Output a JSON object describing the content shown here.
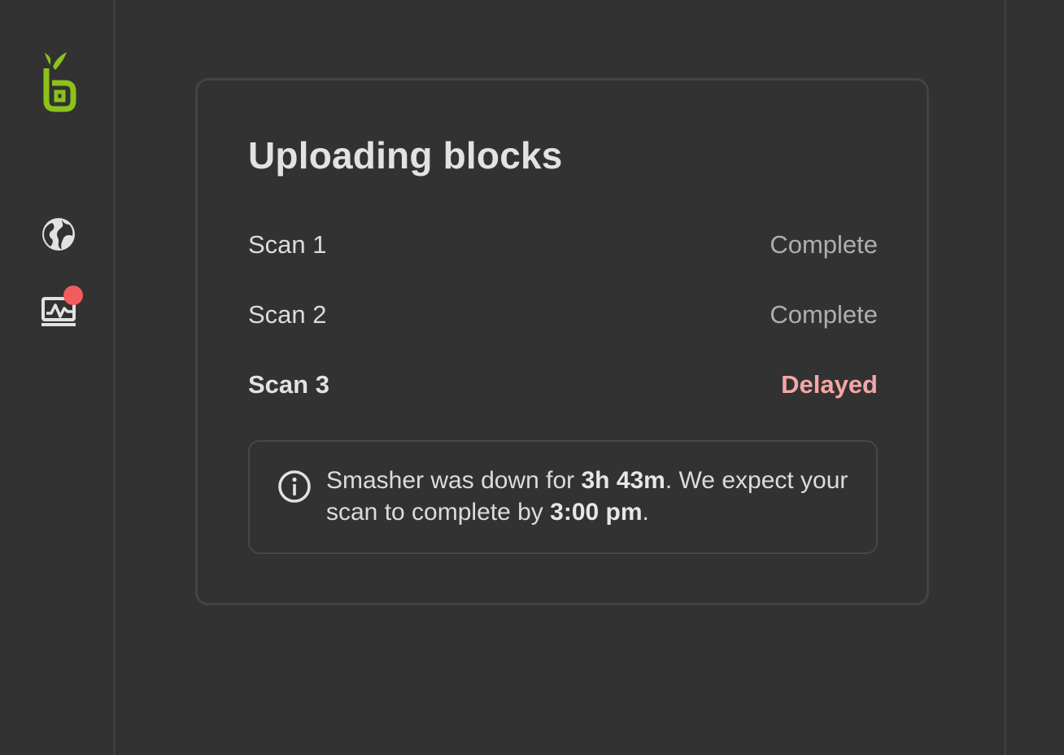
{
  "sidebar": {
    "logo_icon": "sprout-b-logo-icon",
    "items": [
      {
        "icon": "globe-icon",
        "active": false
      },
      {
        "icon": "activity-monitor-icon",
        "has_notification": true
      }
    ]
  },
  "card": {
    "title": "Uploading blocks",
    "scans": [
      {
        "name": "Scan 1",
        "status": "Complete"
      },
      {
        "name": "Scan 2",
        "status": "Complete"
      },
      {
        "name": "Scan 3",
        "status": "Delayed"
      }
    ],
    "notice": {
      "icon": "info-icon",
      "text_before_duration": "Smasher was down for ",
      "duration": "3h 43m",
      "text_middle": ". We expect your scan to complete by ",
      "eta": "3:00 pm",
      "text_end": "."
    }
  },
  "colors": {
    "background": "#323232",
    "border": "#444444",
    "accent_green": "#8cc21a",
    "delayed": "#f4a6a6",
    "notification_dot": "#f25c5c"
  }
}
